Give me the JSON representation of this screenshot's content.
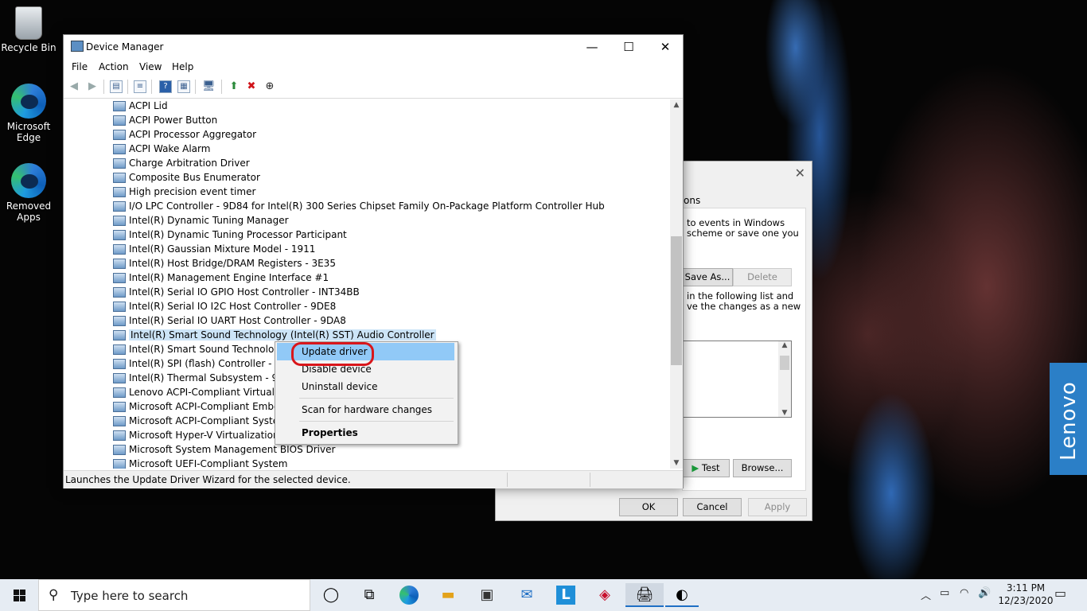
{
  "desktop": {
    "icons": [
      {
        "label": "Recycle Bin"
      },
      {
        "label": "Microsoft Edge"
      },
      {
        "label": "Removed Apps"
      }
    ]
  },
  "window": {
    "title": "Device Manager",
    "menu": [
      "File",
      "Action",
      "View",
      "Help"
    ],
    "devices": [
      "ACPI Lid",
      "ACPI Power Button",
      "ACPI Processor Aggregator",
      "ACPI Wake Alarm",
      "Charge Arbitration Driver",
      "Composite Bus Enumerator",
      "High precision event timer",
      "I/O LPC Controller - 9D84 for Intel(R) 300 Series Chipset Family On-Package Platform Controller Hub",
      "Intel(R) Dynamic Tuning Manager",
      "Intel(R) Dynamic Tuning Processor Participant",
      "Intel(R) Gaussian Mixture Model - 1911",
      "Intel(R) Host Bridge/DRAM Registers - 3E35",
      "Intel(R) Management Engine Interface #1",
      "Intel(R) Serial IO GPIO Host Controller - INT34BB",
      "Intel(R) Serial IO I2C Host Controller - 9DE8",
      "Intel(R) Serial IO UART Host Controller - 9DA8",
      "Intel(R) Smart Sound Technology (Intel(R) SST) Audio Controller",
      "Intel(R) Smart Sound Technology (",
      "Intel(R) SPI (flash) Controller - 9DA",
      "Intel(R) Thermal Subsystem - 9DF9",
      "Lenovo ACPI-Compliant Virtual Po",
      "Microsoft ACPI-Compliant Embed",
      "Microsoft ACPI-Compliant System",
      "Microsoft Hyper-V Virtualization Ir",
      "Microsoft System Management BIOS Driver",
      "Microsoft UEFI-Compliant System"
    ],
    "status": "Launches the Update Driver Wizard for the selected device."
  },
  "context_menu": {
    "update": "Update driver",
    "disable": "Disable device",
    "uninstall": "Uninstall device",
    "scan": "Scan for hardware changes",
    "properties": "Properties"
  },
  "back_dialog": {
    "tab": "ons",
    "text1": "to events in Windows",
    "text2": "scheme or save one you",
    "save_as": "Save As...",
    "delete": "Delete",
    "text3": "in the following list and",
    "text4": "ve the changes as a new",
    "test": "Test",
    "browse": "Browse...",
    "ok": "OK",
    "cancel": "Cancel",
    "apply": "Apply"
  },
  "badge": "Lenovo",
  "taskbar": {
    "search_placeholder": "Type here to search",
    "time": "3:11 PM",
    "date": "12/23/2020"
  }
}
